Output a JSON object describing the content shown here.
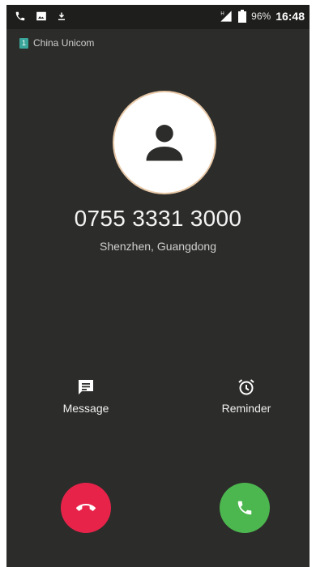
{
  "status_bar": {
    "battery_percent": "96%",
    "time": "16:48",
    "signal_label": "H"
  },
  "carrier": {
    "sim_slot": "1",
    "name": "China Unicom"
  },
  "caller": {
    "number": "0755 3331 3000",
    "location": "Shenzhen, Guangdong"
  },
  "actions": {
    "message_label": "Message",
    "reminder_label": "Reminder"
  },
  "colors": {
    "background": "#2c2c2a",
    "decline": "#e8234a",
    "answer": "#4cb74f",
    "sim_badge": "#3aa59a"
  },
  "icons": {
    "status_left": [
      "phone-icon",
      "image-icon",
      "download-icon"
    ],
    "avatar": "person-icon",
    "message": "message-icon",
    "reminder": "alarm-clock-icon",
    "decline": "hang-up-icon",
    "answer": "phone-icon"
  }
}
